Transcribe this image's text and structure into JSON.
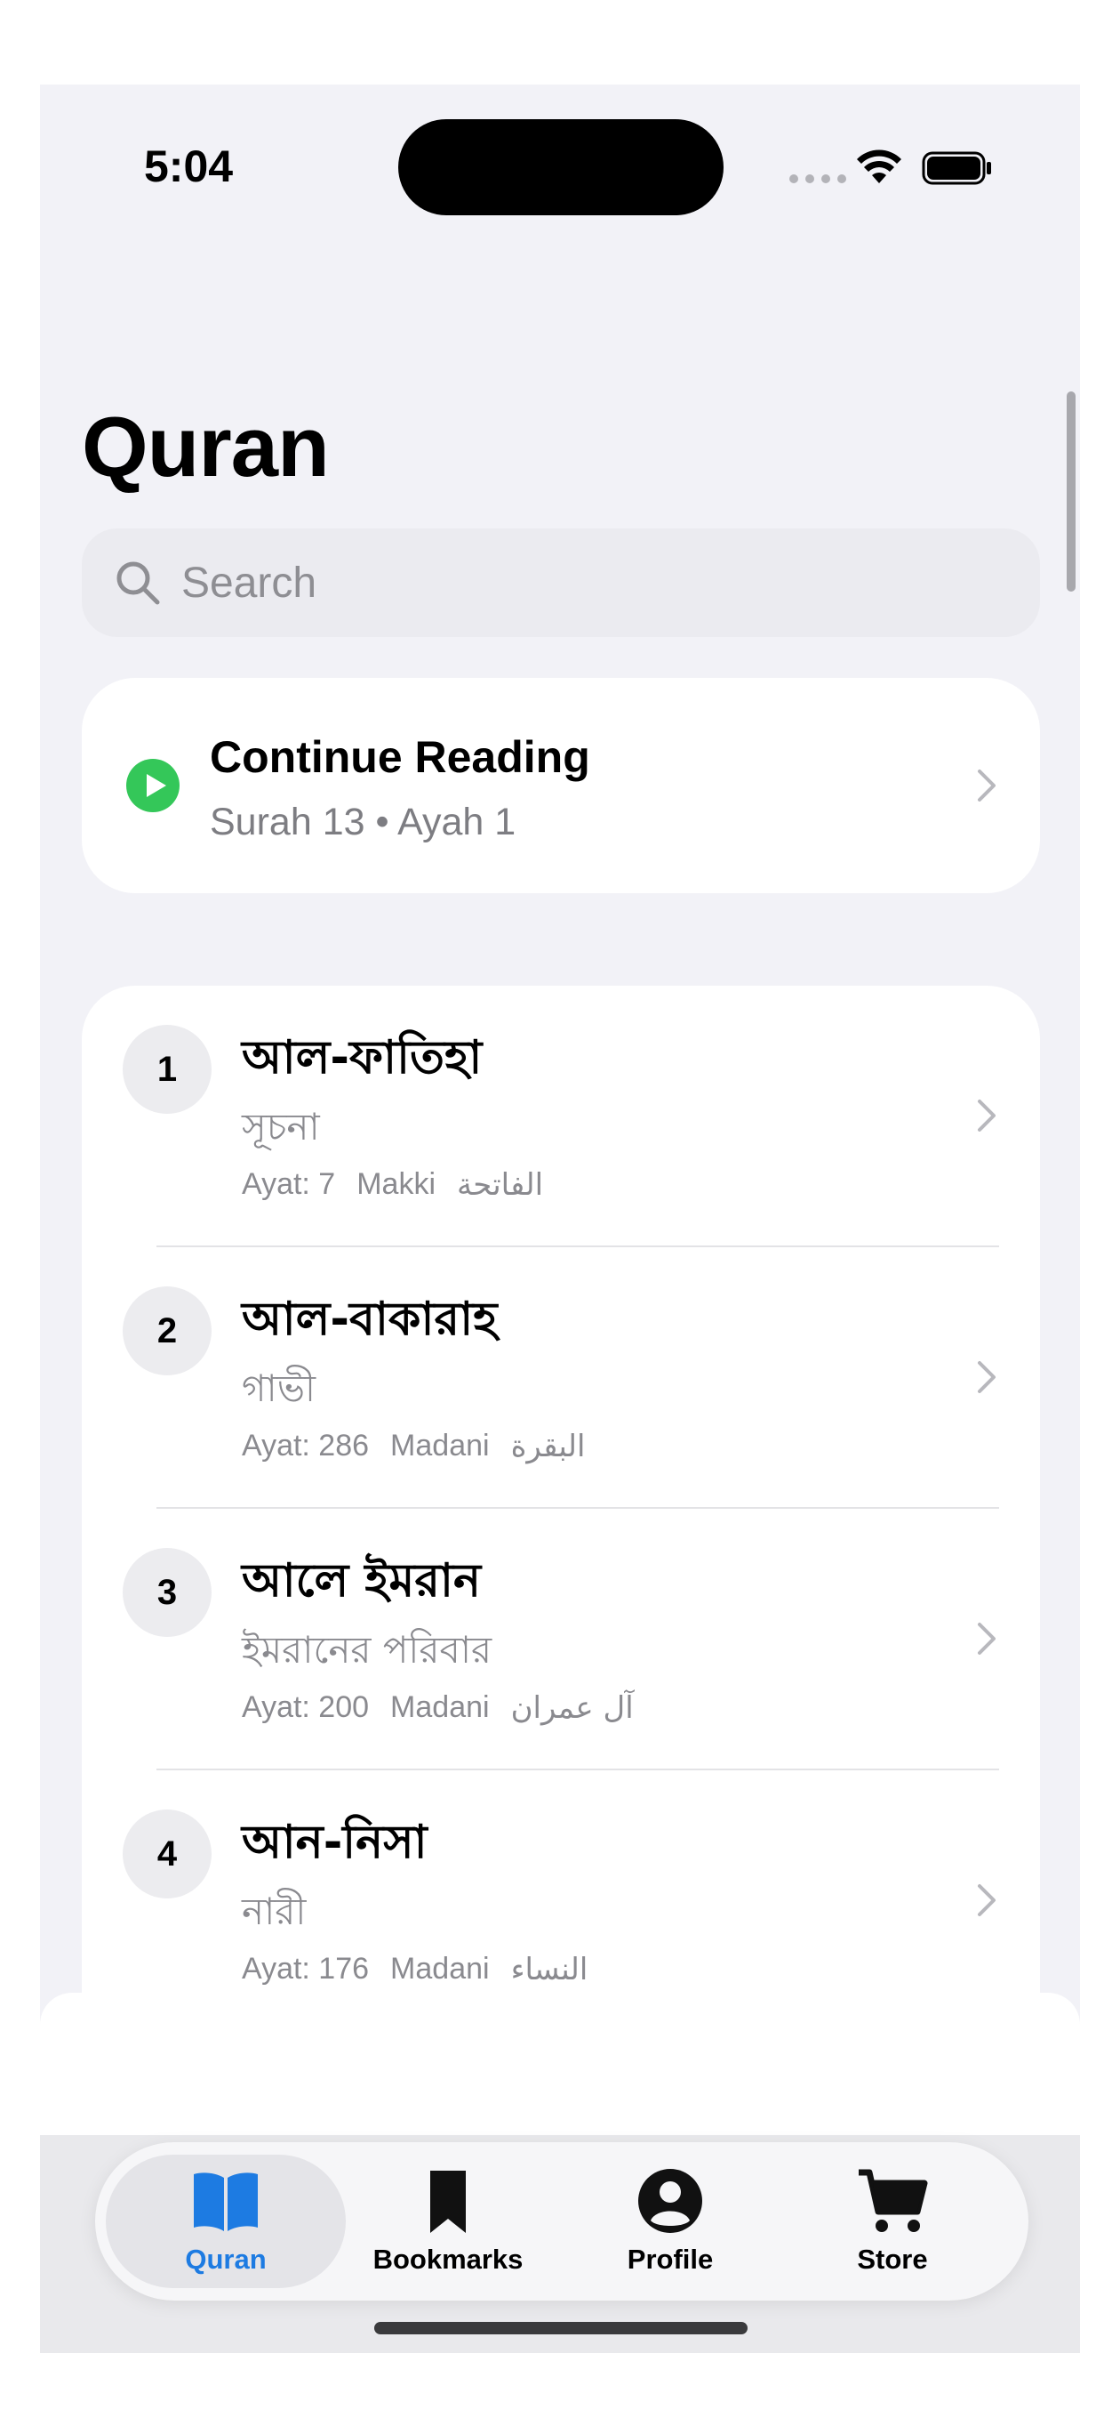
{
  "status_bar": {
    "time": "5:04"
  },
  "page_title": "Quran",
  "search": {
    "placeholder": "Search"
  },
  "continue_reading": {
    "title": "Continue Reading",
    "subtitle": "Surah 13 • Ayah 1"
  },
  "surahs": [
    {
      "number": "1",
      "name": "আল-ফাতিহা",
      "meaning": "সূচনা",
      "ayat": "Ayat: 7",
      "type": "Makki",
      "arabic": "الفاتحة"
    },
    {
      "number": "2",
      "name": "আল-বাকারাহ",
      "meaning": "গাভী",
      "ayat": "Ayat: 286",
      "type": "Madani",
      "arabic": "البقرة"
    },
    {
      "number": "3",
      "name": "আলে ইমরান",
      "meaning": "ইমরানের পরিবার",
      "ayat": "Ayat: 200",
      "type": "Madani",
      "arabic": "آل عمران"
    },
    {
      "number": "4",
      "name": "আন-নিসা",
      "meaning": "নারী",
      "ayat": "Ayat: 176",
      "type": "Madani",
      "arabic": "النساء"
    }
  ],
  "tabs": [
    {
      "label": "Quran",
      "icon": "book-icon",
      "active": true
    },
    {
      "label": "Bookmarks",
      "icon": "bookmark-icon",
      "active": false
    },
    {
      "label": "Profile",
      "icon": "profile-icon",
      "active": false
    },
    {
      "label": "Store",
      "icon": "cart-icon",
      "active": false
    }
  ],
  "colors": {
    "accent": "#1d7be2",
    "play_green": "#34c759",
    "background": "#f2f2f7"
  }
}
